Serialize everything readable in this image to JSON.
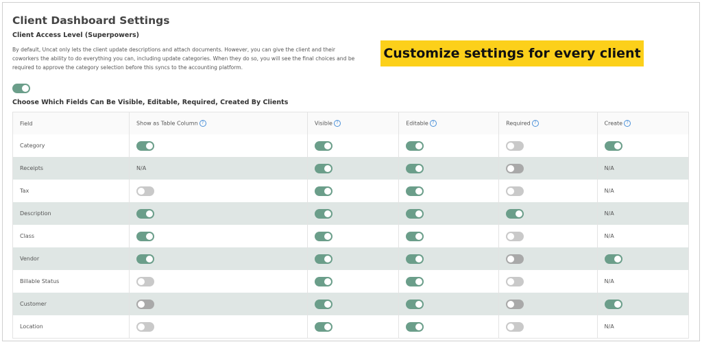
{
  "page": {
    "title": "Client Dashboard Settings",
    "access_level_title": "Client Access Level (Superpowers)",
    "description": "By default, Uncat only lets the client update descriptions and attach documents. However, you can give the client and their coworkers the ability to do everything you can, including update categories. When they do so, you will see the final choices and be required to approve the category selection before this syncs to the accounting platform.",
    "master_toggle": true,
    "fields_title": "Choose Which Fields Can Be Visible, Editable, Required, Created By Clients",
    "banner": "Customize settings for every client"
  },
  "colors": {
    "toggle_on": "#6b9e8a",
    "toggle_off": "#c9c9c9",
    "banner_bg": "#fcd01a",
    "row_alt": "#dfe6e4",
    "help_icon": "#4a90d9"
  },
  "table": {
    "columns": [
      {
        "label": "Field",
        "help": false
      },
      {
        "label": "Show as Table Column",
        "help": true
      },
      {
        "label": "Visible",
        "help": true
      },
      {
        "label": "Editable",
        "help": true
      },
      {
        "label": "Required",
        "help": true
      },
      {
        "label": "Create",
        "help": true
      }
    ],
    "rows": [
      {
        "field": "Category",
        "values": [
          true,
          true,
          true,
          false,
          true
        ]
      },
      {
        "field": "Receipts",
        "values": [
          "N/A",
          true,
          true,
          false,
          "N/A"
        ]
      },
      {
        "field": "Tax",
        "values": [
          false,
          true,
          true,
          false,
          "N/A"
        ]
      },
      {
        "field": "Description",
        "values": [
          true,
          true,
          true,
          true,
          "N/A"
        ]
      },
      {
        "field": "Class",
        "values": [
          true,
          true,
          true,
          false,
          "N/A"
        ]
      },
      {
        "field": "Vendor",
        "values": [
          true,
          true,
          true,
          false,
          true
        ]
      },
      {
        "field": "Billable Status",
        "values": [
          false,
          true,
          true,
          false,
          "N/A"
        ]
      },
      {
        "field": "Customer",
        "values": [
          false,
          true,
          true,
          false,
          true
        ]
      },
      {
        "field": "Location",
        "values": [
          false,
          true,
          true,
          false,
          "N/A"
        ]
      }
    ]
  }
}
